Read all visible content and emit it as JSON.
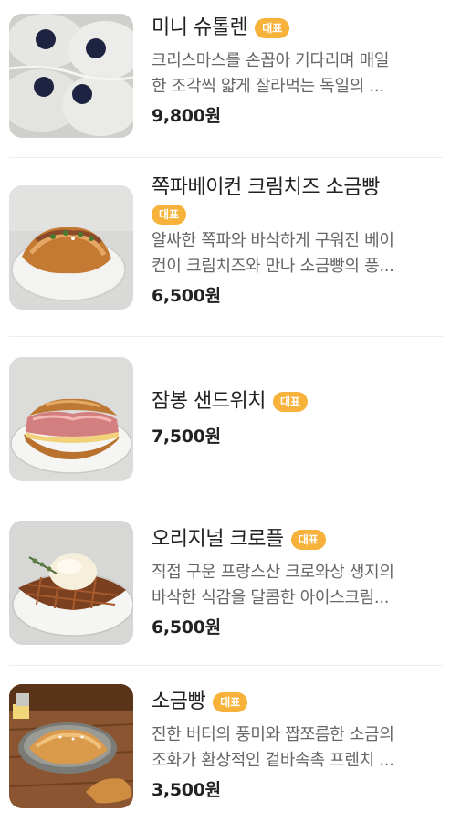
{
  "menu": {
    "items": [
      {
        "name": "미니 슈톨렌",
        "badge": "대표",
        "desc_line1": "크리스마스를 손꼽아 기다리며 매일",
        "desc_line2": "한 조각씩 얇게 잘라먹는 독일의 ...",
        "price": "9,800원",
        "image_icon": "stollen-photo"
      },
      {
        "name": "쪽파베이컨 크림치즈 소금빵",
        "badge": "대표",
        "desc_line1": "알싸한 쪽파와 바삭하게 구워진 베이",
        "desc_line2": "컨이 크림치즈와 만나 소금빵의 풍...",
        "price": "6,500원",
        "image_icon": "salt-bread-bacon-photo"
      },
      {
        "name": "잠봉 샌드위치",
        "badge": "대표",
        "price": "7,500원",
        "image_icon": "jambon-sandwich-photo"
      },
      {
        "name": "오리지널 크로플",
        "badge": "대표",
        "desc_line1": "직접 구운 프랑스산 크로와상 생지의",
        "desc_line2": "바삭한 식감을 달콤한 아이스크림...",
        "price": "6,500원",
        "image_icon": "croffle-photo"
      },
      {
        "name": "소금빵",
        "badge": "대표",
        "desc_line1": "진한 버터의 풍미와 짭쪼름한 소금의",
        "desc_line2": "조화가 환상적인 겉바속촉 프렌치 ...",
        "price": "3,500원",
        "image_icon": "salt-bread-photo"
      }
    ]
  }
}
